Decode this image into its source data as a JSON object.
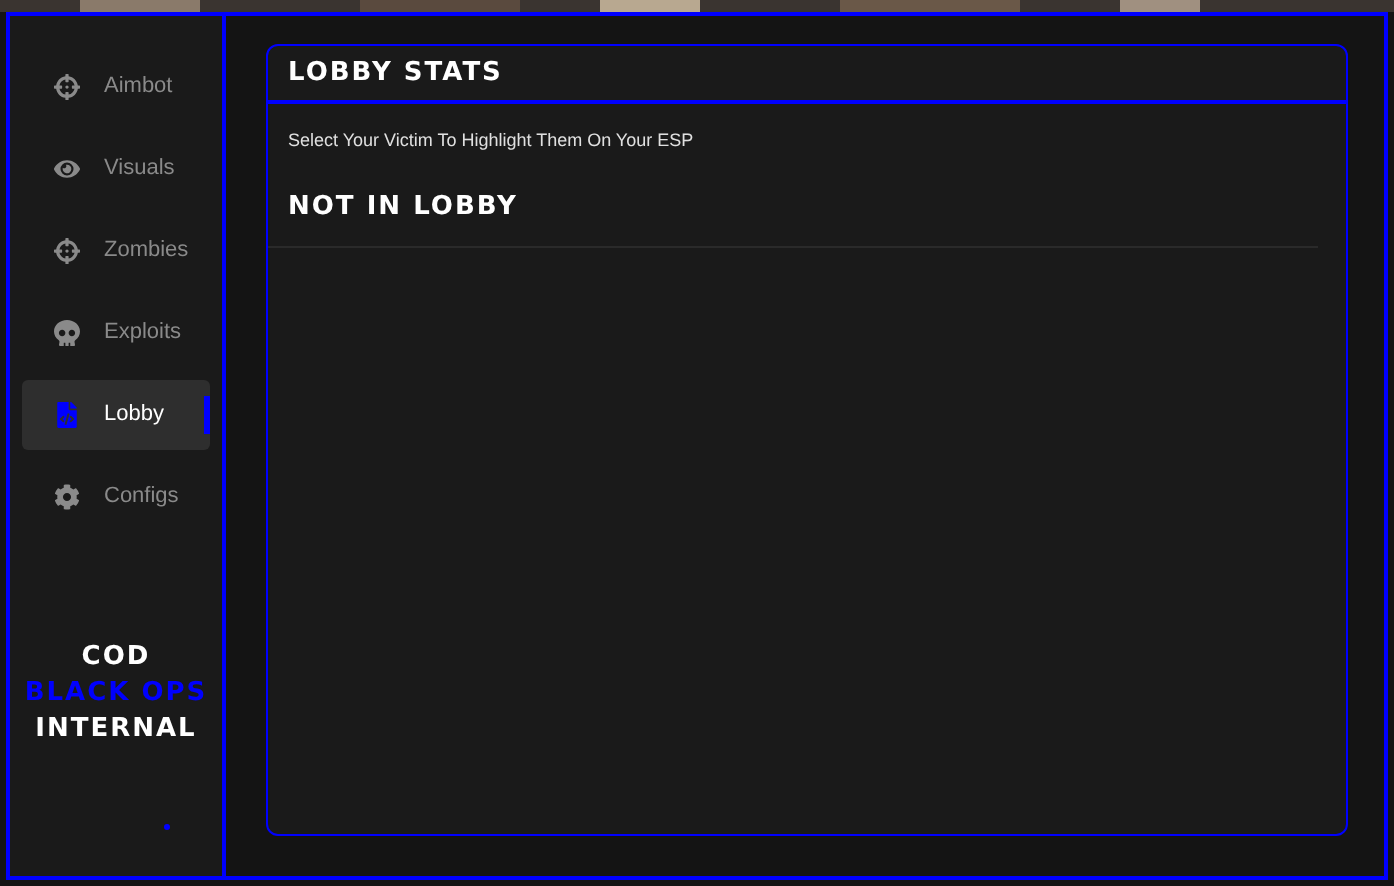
{
  "sidebar": {
    "items": [
      {
        "label": "Aimbot",
        "selected": false
      },
      {
        "label": "Visuals",
        "selected": false
      },
      {
        "label": "Zombies",
        "selected": false
      },
      {
        "label": "Exploits",
        "selected": false
      },
      {
        "label": "Lobby",
        "selected": true
      },
      {
        "label": "Configs",
        "selected": false
      }
    ],
    "logo": [
      {
        "text": "COD",
        "color": "#ffffff"
      },
      {
        "text": "BLACK OPS",
        "color": "#0000ff"
      },
      {
        "text": "INTERNAL",
        "color": "#ffffff"
      }
    ]
  },
  "panel": {
    "title": "LOBBY STATS",
    "description": "Select Your Victim To Highlight Them On Your ESP",
    "status": "NOT IN LOBBY"
  }
}
